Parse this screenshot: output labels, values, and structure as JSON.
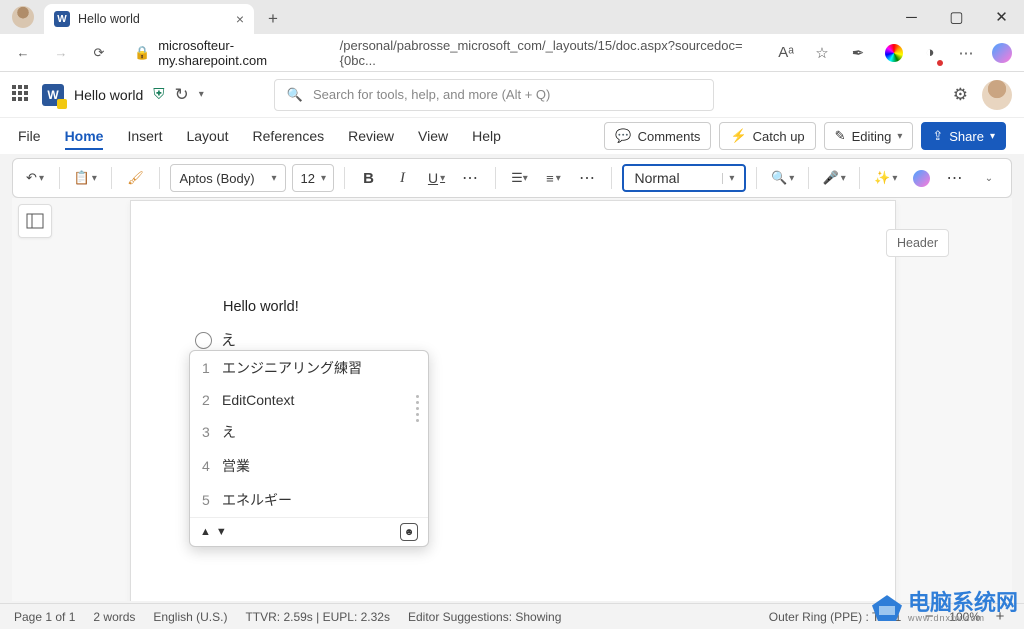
{
  "browser": {
    "tab_title": "Hello world",
    "url_host": "microsofteur-my.sharepoint.com",
    "url_path": "/personal/pabrosse_microsoft_com/_layouts/15/doc.aspx?sourcedoc={0bc...",
    "font_size_label": "Aᵃ"
  },
  "header": {
    "doc_title": "Hello world",
    "search_placeholder": "Search for tools, help, and more (Alt + Q)"
  },
  "menu": {
    "items": [
      "File",
      "Home",
      "Insert",
      "Layout",
      "References",
      "Review",
      "View",
      "Help"
    ],
    "active_index": 1,
    "comments": "Comments",
    "catchup": "Catch up",
    "editing": "Editing",
    "share": "Share"
  },
  "ribbon": {
    "font": "Aptos (Body)",
    "size": "12",
    "style": "Normal"
  },
  "document": {
    "header_label": "Header",
    "body_text": "Hello world!",
    "ime_input": "え"
  },
  "ime": {
    "items": [
      {
        "n": "1",
        "t": "エンジニアリング練習"
      },
      {
        "n": "2",
        "t": "EditContext"
      },
      {
        "n": "3",
        "t": "え"
      },
      {
        "n": "4",
        "t": "営業"
      },
      {
        "n": "5",
        "t": "エネルギー"
      }
    ]
  },
  "status": {
    "page": "Page 1 of 1",
    "words": "2 words",
    "lang": "English (U.S.)",
    "perf": "TTVR: 2.59s | EUPL: 2.32s",
    "editor": "Editor Suggestions: Showing",
    "ring": "Outer Ring (PPE) : TNL1",
    "zoom": "100%"
  },
  "watermark": {
    "main": "电脑系统网",
    "sub": "www.dnxtw.com"
  }
}
